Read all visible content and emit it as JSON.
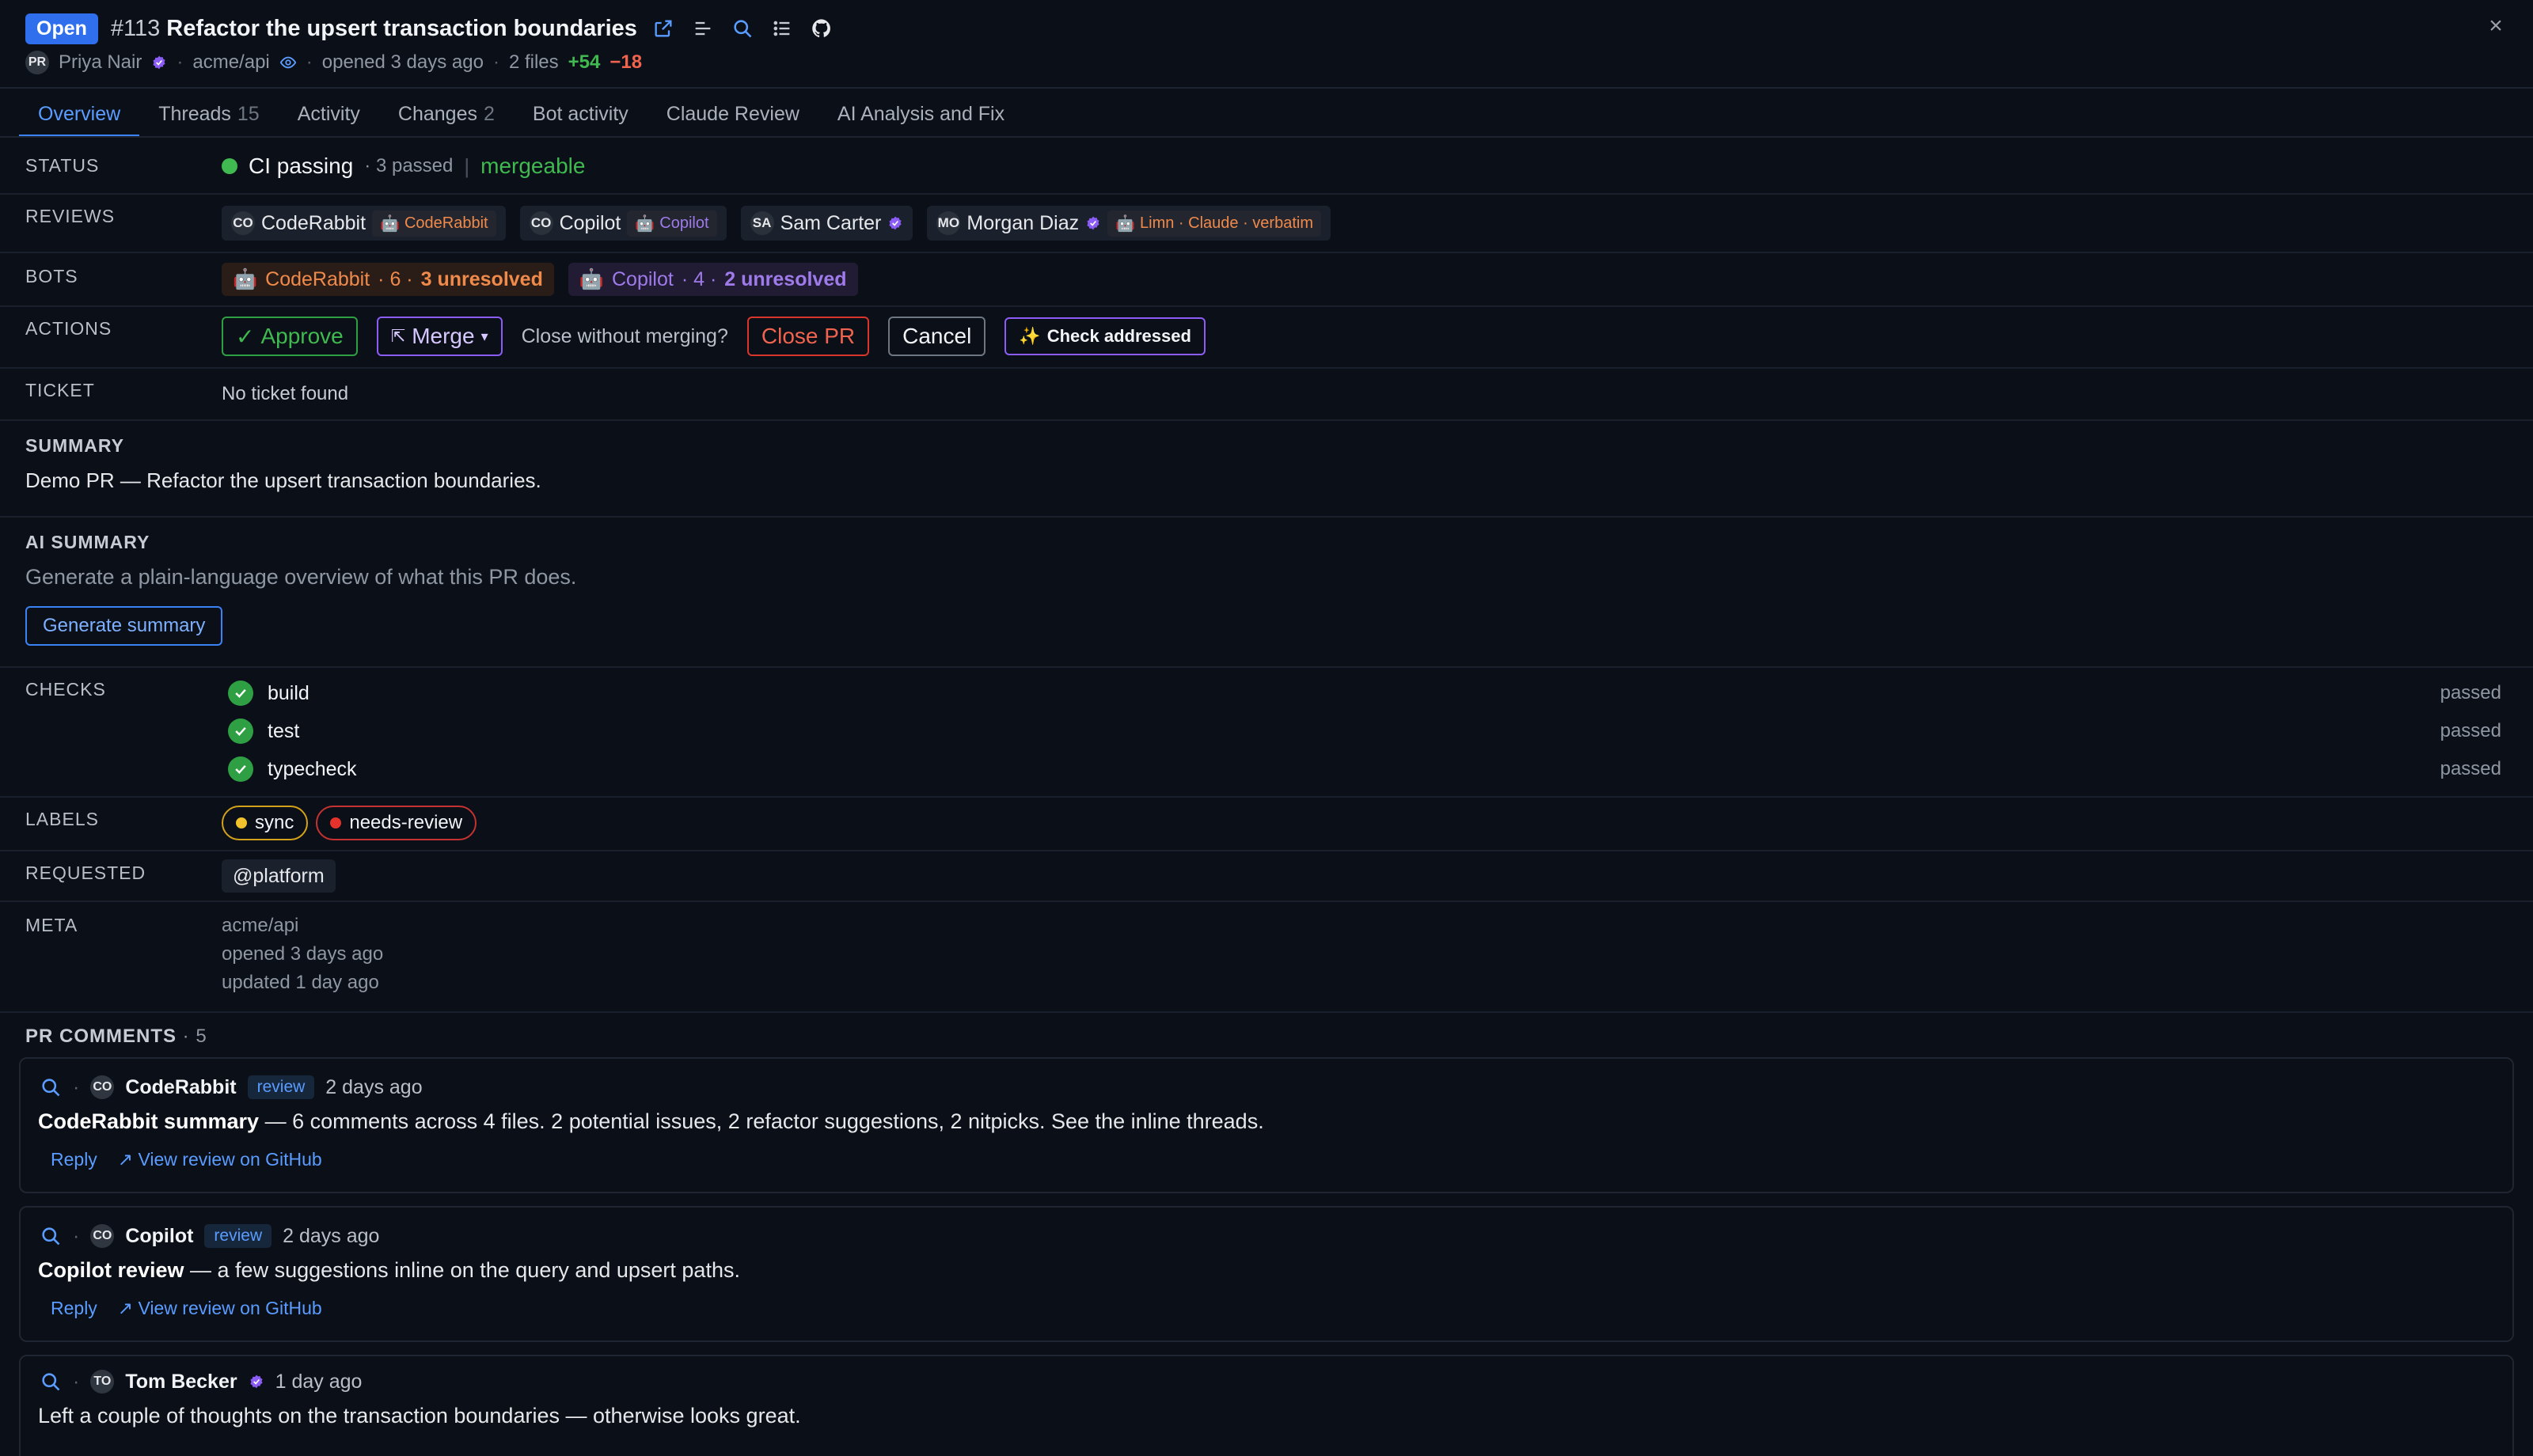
{
  "header": {
    "status_badge": "Open",
    "number": "#113",
    "title": "Refactor the upsert transaction boundaries",
    "author_initials": "PR",
    "author": "Priya Nair",
    "repo": "acme/api",
    "opened": "opened 3 days ago",
    "files": "2 files",
    "additions": "+54",
    "deletions": "−18",
    "close_glyph": "×"
  },
  "tabs": [
    {
      "label": "Overview",
      "count": ""
    },
    {
      "label": "Threads",
      "count": "15"
    },
    {
      "label": "Activity",
      "count": ""
    },
    {
      "label": "Changes",
      "count": "2"
    },
    {
      "label": "Bot activity",
      "count": ""
    },
    {
      "label": "Claude Review",
      "count": ""
    },
    {
      "label": "AI Analysis and Fix",
      "count": ""
    }
  ],
  "status": {
    "label": "STATUS",
    "ci": "CI passing",
    "passed": "· 3 passed",
    "separator": "|",
    "merge_state": "mergeable"
  },
  "reviews": {
    "label": "REVIEWS",
    "items": [
      {
        "initials": "CO",
        "name": "CodeRabbit",
        "bot": "CodeRabbit"
      },
      {
        "initials": "CO",
        "name": "Copilot",
        "bot": "Copilot"
      },
      {
        "initials": "SA",
        "name": "Sam Carter"
      },
      {
        "initials": "MO",
        "name": "Morgan Diaz",
        "bot": "Limn · Claude · verbatim"
      }
    ]
  },
  "bots": {
    "label": "BOTS",
    "coderabbit": {
      "name": "CodeRabbit",
      "count": "· 6 ·",
      "unresolved": "3 unresolved"
    },
    "copilot": {
      "name": "Copilot",
      "count": "· 4 ·",
      "unresolved": "2 unresolved"
    }
  },
  "actions": {
    "label": "ACTIONS",
    "approve": "Approve",
    "approve_glyph": "✓",
    "merge": "Merge",
    "merge_glyph": "⇱",
    "merge_caret": "▾",
    "close_question": "Close without merging?",
    "close_pr": "Close PR",
    "cancel": "Cancel",
    "check_glyph": "✨",
    "check_addressed": "Check addressed"
  },
  "ticket": {
    "label": "TICKET",
    "value": "No ticket found"
  },
  "summary": {
    "title": "SUMMARY",
    "text": "Demo PR — Refactor the upsert transaction boundaries."
  },
  "ai_summary": {
    "title": "AI SUMMARY",
    "text": "Generate a plain-language overview of what this PR does.",
    "button": "Generate summary"
  },
  "checks": {
    "label": "CHECKS",
    "items": [
      {
        "name": "build",
        "status": "passed"
      },
      {
        "name": "test",
        "status": "passed"
      },
      {
        "name": "typecheck",
        "status": "passed"
      }
    ]
  },
  "labels": {
    "label": "LABELS",
    "sync": "sync",
    "needs_review": "needs-review"
  },
  "requested": {
    "label": "REQUESTED",
    "value": "@platform"
  },
  "meta": {
    "label": "META",
    "repo": "acme/api",
    "opened": "opened 3 days ago",
    "updated": "updated 1 day ago"
  },
  "comments": {
    "title": "PR COMMENTS",
    "count": "· 5",
    "items": [
      {
        "initials": "CO",
        "author": "CodeRabbit",
        "tag": "review",
        "when": "2 days ago",
        "bold": "CodeRabbit summary",
        "text": " — 6 comments across 4 files. 2 potential issues, 2 refactor suggestions, 2 nitpicks. See the inline threads.",
        "reply": "Reply",
        "link": "↗ View review on GitHub"
      },
      {
        "initials": "CO",
        "author": "Copilot",
        "tag": "review",
        "when": "2 days ago",
        "bold": "Copilot review",
        "text": " — a few suggestions inline on the query and upsert paths.",
        "reply": "Reply",
        "link": "↗ View review on GitHub"
      },
      {
        "initials": "TO",
        "author": "Tom Becker",
        "when": "1 day ago",
        "text": "Left a couple of thoughts on the transaction boundaries — otherwise looks great."
      }
    ]
  },
  "colors": {
    "background": "#0b0f17",
    "accent": "#3b82f6",
    "success": "#3fb950",
    "danger": "#f0644f",
    "coderabbit": "#f08a4b",
    "copilot": "#9f7aea"
  }
}
